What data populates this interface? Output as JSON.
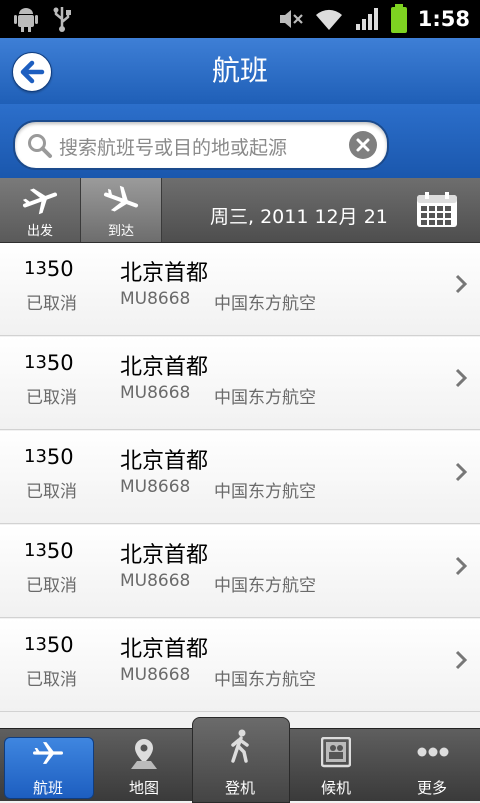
{
  "status_bar": {
    "time": "1:58"
  },
  "header": {
    "title": "航班",
    "back_icon": "back-arrow-icon"
  },
  "search": {
    "placeholder": "搜索航班号或目的地或起源"
  },
  "filter": {
    "departure_label": "出发",
    "arrival_label": "到达",
    "date": "周三, 2011 12月  21"
  },
  "flights": [
    {
      "time_hour": "13",
      "time_min": "50",
      "city": "北京首都",
      "status": "已取消",
      "flight_no": "MU8668",
      "airline": "中国东方航空"
    },
    {
      "time_hour": "13",
      "time_min": "50",
      "city": "北京首都",
      "status": "已取消",
      "flight_no": "MU8668",
      "airline": "中国东方航空"
    },
    {
      "time_hour": "13",
      "time_min": "50",
      "city": "北京首都",
      "status": "已取消",
      "flight_no": "MU8668",
      "airline": "中国东方航空"
    },
    {
      "time_hour": "13",
      "time_min": "50",
      "city": "北京首都",
      "status": "已取消",
      "flight_no": "MU8668",
      "airline": "中国东方航空"
    },
    {
      "time_hour": "13",
      "time_min": "50",
      "city": "北京首都",
      "status": "已取消",
      "flight_no": "MU8668",
      "airline": "中国东方航空"
    }
  ],
  "tabs": [
    {
      "label": "航班",
      "icon": "plane-icon",
      "active": true
    },
    {
      "label": "地图",
      "icon": "map-pin-icon",
      "active": false
    },
    {
      "label": "登机",
      "icon": "walking-person-icon",
      "active": false
    },
    {
      "label": "候机",
      "icon": "lounge-icon",
      "active": false
    },
    {
      "label": "更多",
      "icon": "more-dots-icon",
      "active": false
    }
  ],
  "colors": {
    "header_blue": "#2a6ac8",
    "tab_active": "#2f74d4",
    "filter_gray": "#5a5a5a"
  }
}
